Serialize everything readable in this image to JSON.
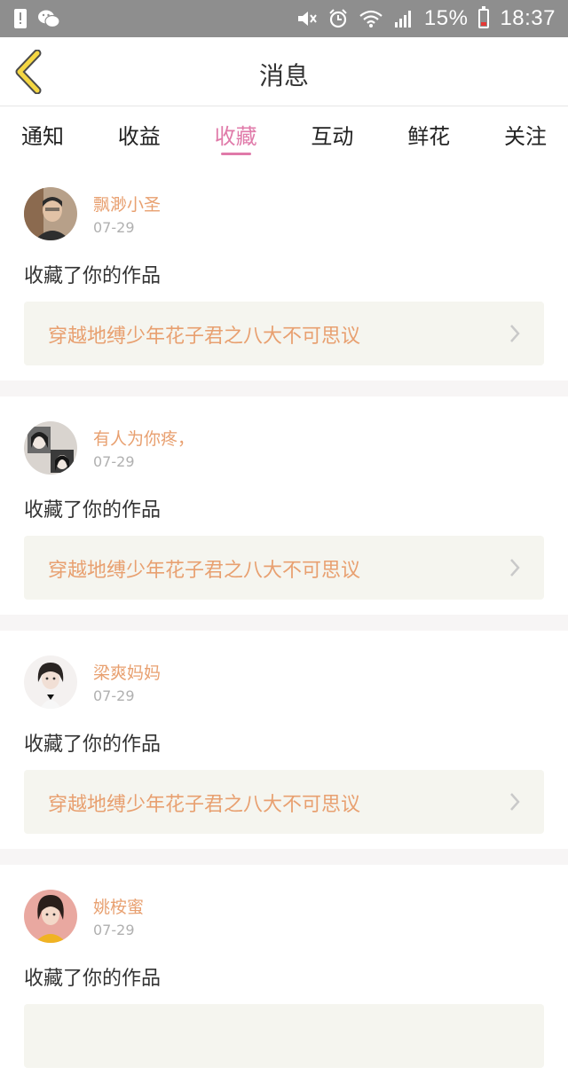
{
  "status_bar": {
    "battery_percent": "15%",
    "time": "18:37"
  },
  "header": {
    "title": "消息",
    "back_icon": "chevron-left-icon",
    "back_color": "#f5d743"
  },
  "tabs": [
    {
      "label": "通知",
      "active": false
    },
    {
      "label": "收益",
      "active": false
    },
    {
      "label": "收藏",
      "active": true
    },
    {
      "label": "互动",
      "active": false
    },
    {
      "label": "鲜花",
      "active": false
    },
    {
      "label": "关注",
      "active": false
    }
  ],
  "accent_color": "#e07aa9",
  "name_color": "#e8a070",
  "messages": [
    {
      "username": "飘渺小圣",
      "date": "07-29",
      "action": "收藏了你的作品",
      "work_title": "穿越地缚少年花子君之八大不可思议"
    },
    {
      "username": "有人为你疼，",
      "date": "07-29",
      "action": "收藏了你的作品",
      "work_title": "穿越地缚少年花子君之八大不可思议"
    },
    {
      "username": "梁爽妈妈",
      "date": "07-29",
      "action": "收藏了你的作品",
      "work_title": "穿越地缚少年花子君之八大不可思议"
    },
    {
      "username": "姚桉蜜",
      "date": "07-29",
      "action": "收藏了你的作品",
      "work_title": ""
    }
  ]
}
